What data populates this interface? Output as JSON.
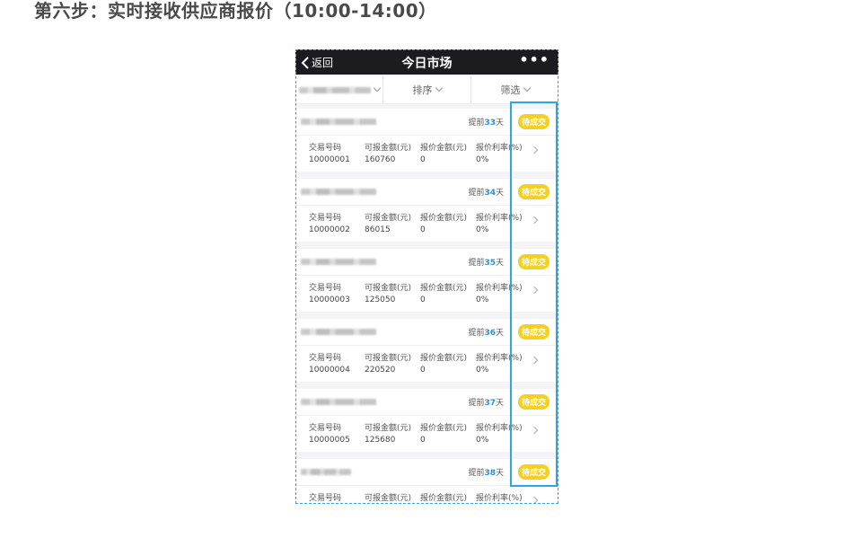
{
  "page_title": "第六步：实时接收供应商报价（10:00-14:00）",
  "nav": {
    "back_label": "返回",
    "title": "今日市场",
    "more_label": "•••"
  },
  "filters": {
    "sort_label": "排序",
    "filter_label": "筛选"
  },
  "columns": {
    "trade_no": "交易号码",
    "quotable": "可报金额(元)",
    "quote_amount": "报价金额(元)",
    "quote_rate": "报价利率(%)"
  },
  "days_prefix": "提前",
  "days_suffix": "天",
  "cards": [
    {
      "days": "33",
      "status": "待成交",
      "trade_no": "10000001",
      "quotable": "160760",
      "quote_amount": "0",
      "quote_rate": "0%"
    },
    {
      "days": "34",
      "status": "待成交",
      "trade_no": "10000002",
      "quotable": "86015",
      "quote_amount": "0",
      "quote_rate": "0%"
    },
    {
      "days": "35",
      "status": "待成交",
      "trade_no": "10000003",
      "quotable": "125050",
      "quote_amount": "0",
      "quote_rate": "0%"
    },
    {
      "days": "36",
      "status": "待成交",
      "trade_no": "10000004",
      "quotable": "220520",
      "quote_amount": "0",
      "quote_rate": "0%"
    },
    {
      "days": "37",
      "status": "待成交",
      "trade_no": "10000005",
      "quotable": "125680",
      "quote_amount": "0",
      "quote_rate": "0%"
    },
    {
      "days": "38",
      "status": "待成交",
      "trade_no": "",
      "quotable": "",
      "quote_amount": "",
      "quote_rate": ""
    }
  ],
  "colors": {
    "nav_bg": "#1c1b20",
    "badge": "#f5d020",
    "highlight": "#2aa6e6",
    "days_num": "#2a8de0"
  }
}
